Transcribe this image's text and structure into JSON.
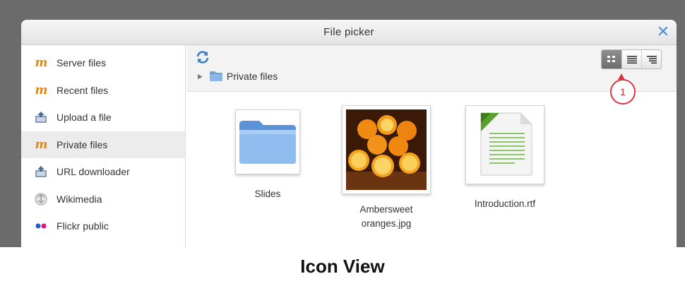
{
  "dialog": {
    "title": "File picker",
    "close_icon": "close-icon",
    "accent_color": "#4a8fd6"
  },
  "sidebar": {
    "items": [
      {
        "label": "Server files",
        "icon": "moodle-icon"
      },
      {
        "label": "Recent files",
        "icon": "moodle-icon"
      },
      {
        "label": "Upload a file",
        "icon": "upload-icon"
      },
      {
        "label": "Private files",
        "icon": "moodle-icon",
        "active": true
      },
      {
        "label": "URL downloader",
        "icon": "url-download-icon"
      },
      {
        "label": "Wikimedia",
        "icon": "wikimedia-icon"
      },
      {
        "label": "Flickr public",
        "icon": "flickr-icon"
      }
    ]
  },
  "toolbar": {
    "refresh_icon": "refresh-icon",
    "breadcrumb": {
      "label": "Private files"
    },
    "view_buttons": [
      {
        "name": "icon-view",
        "active": true
      },
      {
        "name": "list-view",
        "active": false
      },
      {
        "name": "tree-view",
        "active": false
      }
    ],
    "callout_number": "1"
  },
  "files": [
    {
      "name": "Slides",
      "type": "folder"
    },
    {
      "name_line1": "Ambersweet",
      "name_line2": "oranges.jpg",
      "type": "image"
    },
    {
      "name": "Introduction.rtf",
      "type": "document"
    }
  ],
  "caption": "Icon View"
}
